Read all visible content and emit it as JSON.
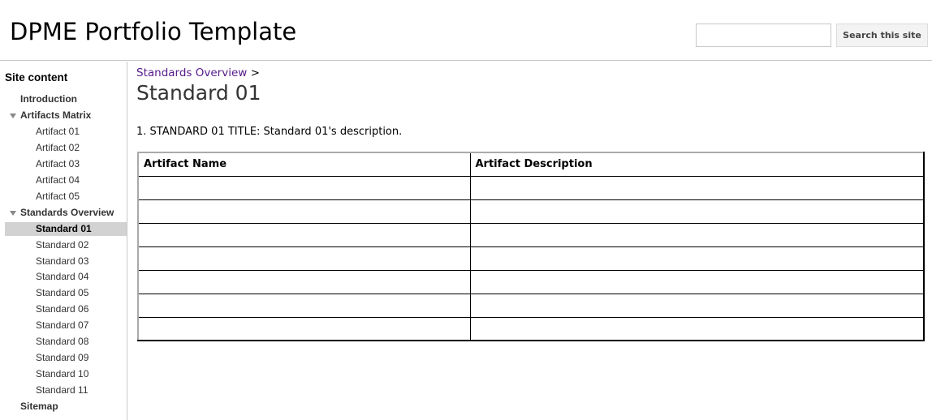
{
  "header": {
    "site_title": "DPME Portfolio Template",
    "search_placeholder": "",
    "search_value": "",
    "search_button": "Search this site"
  },
  "sidebar": {
    "title": "Site content",
    "items": [
      {
        "label": "Introduction",
        "level": 1,
        "expandable": false
      },
      {
        "label": "Artifacts Matrix",
        "level": 1,
        "expandable": true,
        "expanded": true
      },
      {
        "label": "Artifact 01",
        "level": 2
      },
      {
        "label": "Artifact 02",
        "level": 2
      },
      {
        "label": "Artifact 03",
        "level": 2
      },
      {
        "label": "Artifact 04",
        "level": 2
      },
      {
        "label": "Artifact 05",
        "level": 2
      },
      {
        "label": "Standards Overview",
        "level": 1,
        "expandable": true,
        "expanded": true
      },
      {
        "label": "Standard 01",
        "level": 2,
        "selected": true
      },
      {
        "label": "Standard 02",
        "level": 2
      },
      {
        "label": "Standard 03",
        "level": 2
      },
      {
        "label": "Standard 04",
        "level": 2
      },
      {
        "label": "Standard 05",
        "level": 2
      },
      {
        "label": "Standard 06",
        "level": 2
      },
      {
        "label": "Standard 07",
        "level": 2
      },
      {
        "label": "Standard 08",
        "level": 2
      },
      {
        "label": "Standard 09",
        "level": 2
      },
      {
        "label": "Standard 10",
        "level": 2
      },
      {
        "label": "Standard 11",
        "level": 2
      },
      {
        "label": "Sitemap",
        "level": 1,
        "expandable": false
      }
    ]
  },
  "main": {
    "breadcrumb": {
      "parent": "Standards Overview",
      "separator": ">"
    },
    "title": "Standard 01",
    "description": "1. STANDARD 01 TITLE: Standard 01's description.",
    "table": {
      "headers": [
        "Artifact Name",
        "Artifact Description"
      ],
      "rows": [
        [
          "",
          ""
        ],
        [
          "",
          ""
        ],
        [
          "",
          ""
        ],
        [
          "",
          ""
        ],
        [
          "",
          ""
        ],
        [
          "",
          ""
        ],
        [
          "",
          ""
        ]
      ]
    }
  },
  "colors": {
    "link_visited": "#551a8b",
    "selected_bg": "#d2d2d2",
    "border": "#c8c8c8"
  }
}
